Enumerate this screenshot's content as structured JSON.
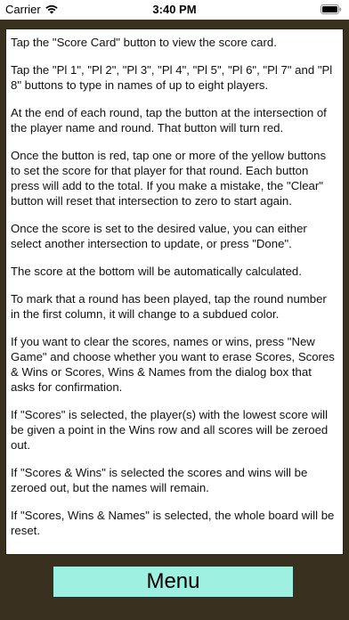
{
  "status_bar": {
    "carrier": "Carrier",
    "time": "3:40 PM"
  },
  "instructions": [
    "Tap the \"Score Card\" button to view the score card.",
    "Tap the \"Pl 1\", \"Pl 2\", \"Pl 3\", \"Pl 4\", \"Pl 5\", \"Pl 6\", \"Pl 7\" and \"Pl 8\" buttons to type in names of up to eight players.",
    "At the end of each round, tap the button at the intersection of the player name and round. That button will turn red.",
    "Once the button is red, tap one or more of the yellow buttons to set the score for that player for that round. Each button press will add to the total. If you make a mistake, the \"Clear\" button will reset that intersection to zero to start again.",
    "Once the score is set to the desired value, you can either select another intersection to update, or press \"Done\".",
    "The score at the bottom will be automatically calculated.",
    "To mark that a round has been played, tap the round number in the first column, it will change to a subdued color.",
    "If you want to clear the scores, names or wins, press \"New Game\" and choose whether you want to erase Scores, Scores & Wins or Scores, Wins & Names from the dialog box that asks for confirmation.",
    "If \"Scores\" is selected, the player(s) with the lowest score will be given a point in the Wins row and all scores will be zeroed out.",
    "If \"Scores & Wins\" is selected the scores and wins will be zeroed out, but the names will remain.",
    "If \"Scores, Wins & Names\" is selected, the whole board will be reset."
  ],
  "menu_button": {
    "label": "Menu"
  },
  "colors": {
    "background": "#3a3020",
    "menu_button": "#9ef0e0"
  },
  "icons": [
    "wifi-icon",
    "battery-icon"
  ]
}
